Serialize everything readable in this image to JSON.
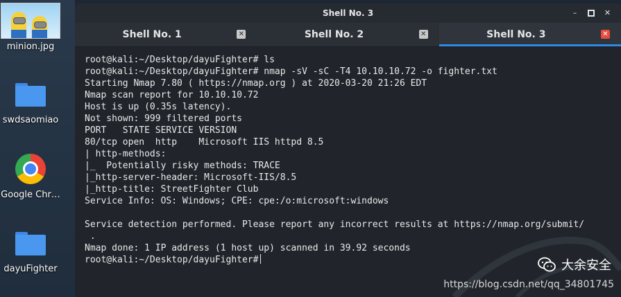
{
  "desktop": {
    "icons": [
      {
        "label": "minion.jpg",
        "icon": "minion-image-icon"
      },
      {
        "label": "swdsaomiao",
        "icon": "folder-icon"
      },
      {
        "label": "Google Chr…",
        "icon": "chrome-icon"
      },
      {
        "label": "dayuFighter",
        "icon": "folder-icon"
      }
    ]
  },
  "window": {
    "title": "Shell No. 3",
    "controls": {
      "minimize": "–",
      "maximize": "□",
      "close": "✕"
    },
    "tabs": [
      {
        "label": "Shell No. 1",
        "close": "✕",
        "active": false
      },
      {
        "label": "Shell No. 2",
        "close": "✕",
        "active": false
      },
      {
        "label": "Shell No. 3",
        "close": "✕",
        "active": true
      }
    ]
  },
  "terminal": {
    "lines": [
      "root@kali:~/Desktop/dayuFighter# ls",
      "root@kali:~/Desktop/dayuFighter# nmap -sV -sC -T4 10.10.10.72 -o fighter.txt",
      "Starting Nmap 7.80 ( https://nmap.org ) at 2020-03-20 21:26 EDT",
      "Nmap scan report for 10.10.10.72",
      "Host is up (0.35s latency).",
      "Not shown: 999 filtered ports",
      "PORT   STATE SERVICE VERSION",
      "80/tcp open  http    Microsoft IIS httpd 8.5",
      "| http-methods:",
      "|_  Potentially risky methods: TRACE",
      "|_http-server-header: Microsoft-IIS/8.5",
      "|_http-title: StreetFighter Club",
      "Service Info: OS: Windows; CPE: cpe:/o:microsoft:windows",
      "",
      "Service detection performed. Please report any incorrect results at https://nmap.org/submit/",
      " .",
      "Nmap done: 1 IP address (1 host up) scanned in 39.92 seconds",
      "root@kali:~/Desktop/dayuFighter#"
    ]
  },
  "watermark": {
    "brand": "大余安全",
    "url": "https://blog.csdn.net/qq_34801745"
  },
  "colors": {
    "terminal_bg": "#21252b",
    "text": "#e9e9e9",
    "active_tab_indicator": "#2e8be6",
    "active_close": "#e74c3c"
  }
}
